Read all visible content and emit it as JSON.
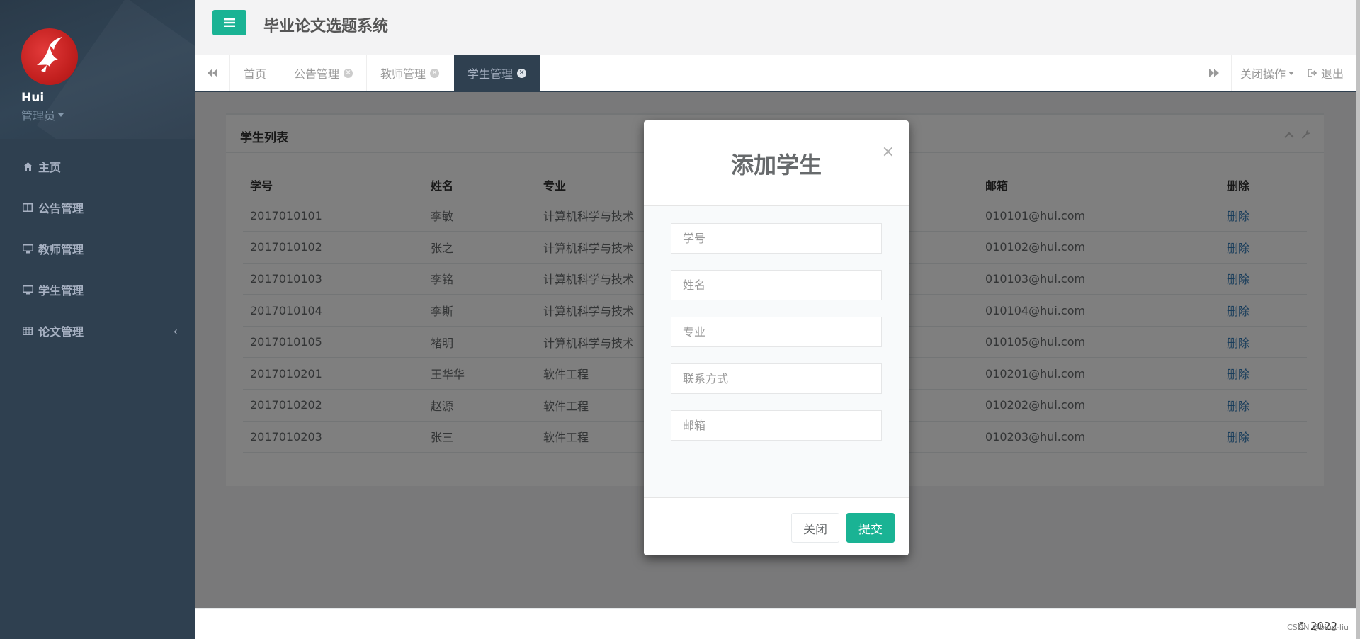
{
  "app": {
    "title": "毕业论文选题系统"
  },
  "profile": {
    "name": "Hui",
    "role": "管理员"
  },
  "sidebar": {
    "items": [
      {
        "label": "主页",
        "icon": "home-icon"
      },
      {
        "label": "公告管理",
        "icon": "columns-icon"
      },
      {
        "label": "教师管理",
        "icon": "desktop-icon"
      },
      {
        "label": "学生管理",
        "icon": "desktop-icon"
      },
      {
        "label": "论文管理",
        "icon": "table-icon"
      }
    ]
  },
  "tabs": {
    "items": [
      {
        "label": "首页"
      },
      {
        "label": "公告管理"
      },
      {
        "label": "教师管理"
      },
      {
        "label": "学生管理",
        "active": true
      }
    ],
    "close_actions": "关闭操作",
    "logout": "退出"
  },
  "panel": {
    "title": "学生列表",
    "columns": [
      "学号",
      "姓名",
      "专业",
      "邮箱",
      "删除"
    ],
    "rows": [
      {
        "id": "2017010101",
        "name": "李敏",
        "major": "计算机科学与技术",
        "email": "010101@hui.com",
        "action": "删除"
      },
      {
        "id": "2017010102",
        "name": "张之",
        "major": "计算机科学与技术",
        "email": "010102@hui.com",
        "action": "删除"
      },
      {
        "id": "2017010103",
        "name": "李铭",
        "major": "计算机科学与技术",
        "email": "010103@hui.com",
        "action": "删除"
      },
      {
        "id": "2017010104",
        "name": "李斯",
        "major": "计算机科学与技术",
        "email": "010104@hui.com",
        "action": "删除"
      },
      {
        "id": "2017010105",
        "name": "褚明",
        "major": "计算机科学与技术",
        "email": "010105@hui.com",
        "action": "删除"
      },
      {
        "id": "2017010201",
        "name": "王华华",
        "major": "软件工程",
        "email": "010201@hui.com",
        "action": "删除"
      },
      {
        "id": "2017010202",
        "name": "赵源",
        "major": "软件工程",
        "email": "010202@hui.com",
        "action": "删除"
      },
      {
        "id": "2017010203",
        "name": "张三",
        "major": "软件工程",
        "email": "010203@hui.com",
        "action": "删除"
      }
    ]
  },
  "modal": {
    "title": "添加学生",
    "close_symbol": "×",
    "fields": [
      {
        "placeholder": "学号"
      },
      {
        "placeholder": "姓名"
      },
      {
        "placeholder": "专业"
      },
      {
        "placeholder": "联系方式"
      },
      {
        "placeholder": "邮箱"
      }
    ],
    "close_label": "关闭",
    "submit_label": "提交"
  },
  "footer": {
    "text": "© 2022",
    "watermark": "CSDN @bing-liu"
  },
  "colors": {
    "accent": "#1ab394",
    "sidebar": "#2f4050",
    "link": "#337ab7"
  }
}
